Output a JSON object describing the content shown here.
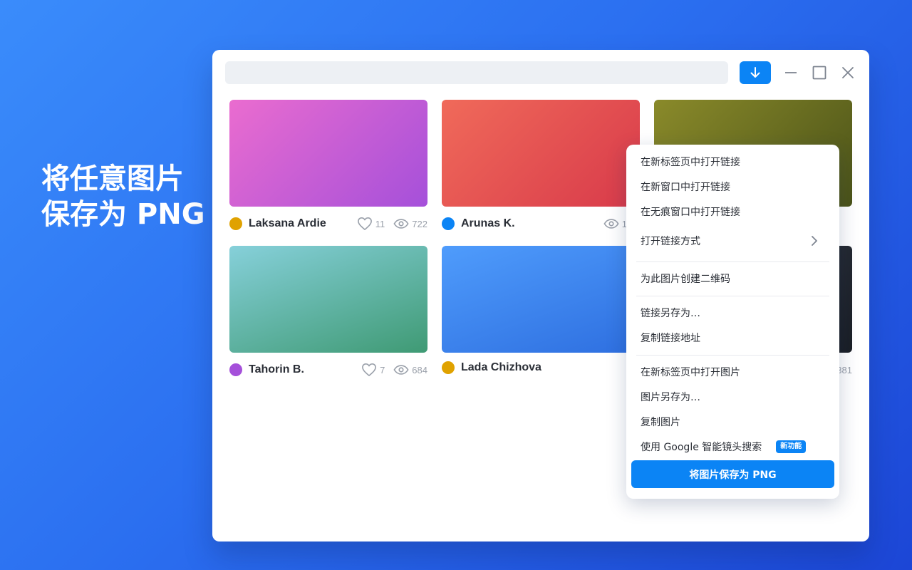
{
  "headline": {
    "line1": "将任意图片",
    "line2": "保存为 PNG"
  },
  "toolbar": {
    "download_icon": "arrow-down-icon",
    "minimize_icon": "minimize-icon",
    "maximize_icon": "maximize-icon",
    "close_icon": "close-icon"
  },
  "cards": [
    {
      "author": "Laksana Ardie",
      "likes": "11",
      "views": "722",
      "avatar_color": "#e0a200",
      "gradient": [
        "#ea6ccf",
        "#a550da"
      ]
    },
    {
      "author": "Arunas K.",
      "views": "1",
      "avatar_color": "#0b84f5",
      "gradient": [
        "#f06a5a",
        "#d83a4a"
      ]
    },
    {
      "author": "",
      "gradient": [
        "#8a8a2a",
        "#4a5218"
      ]
    },
    {
      "author": "Tahorin B.",
      "likes": "7",
      "views": "684",
      "avatar_color": "#a550da",
      "gradient": [
        "#86d0da",
        "#3f9a74"
      ]
    },
    {
      "author": "Lada Chizhova",
      "avatar_color": "#e0a200",
      "gradient": [
        "#4f9cfc",
        "#2e6fe0"
      ]
    },
    {
      "author": "",
      "views": "381",
      "gradient": [
        "#2a2f38",
        "#1a1e25"
      ]
    }
  ],
  "context_menu": {
    "open_link_new_tab": "在新标签页中打开链接",
    "open_link_new_window": "在新窗口中打开链接",
    "open_link_incognito": "在无痕窗口中打开链接",
    "open_link_with": "打开链接方式",
    "create_qr": "为此图片创建二维码",
    "save_link_as": "链接另存为…",
    "copy_link": "复制链接地址",
    "open_image_new_tab": "在新标签页中打开图片",
    "save_image_as": "图片另存为…",
    "copy_image": "复制图片",
    "google_lens": "使用 Google 智能镜头搜索",
    "new_badge": "新功能",
    "save_as_png": "将图片保存为 PNG"
  }
}
